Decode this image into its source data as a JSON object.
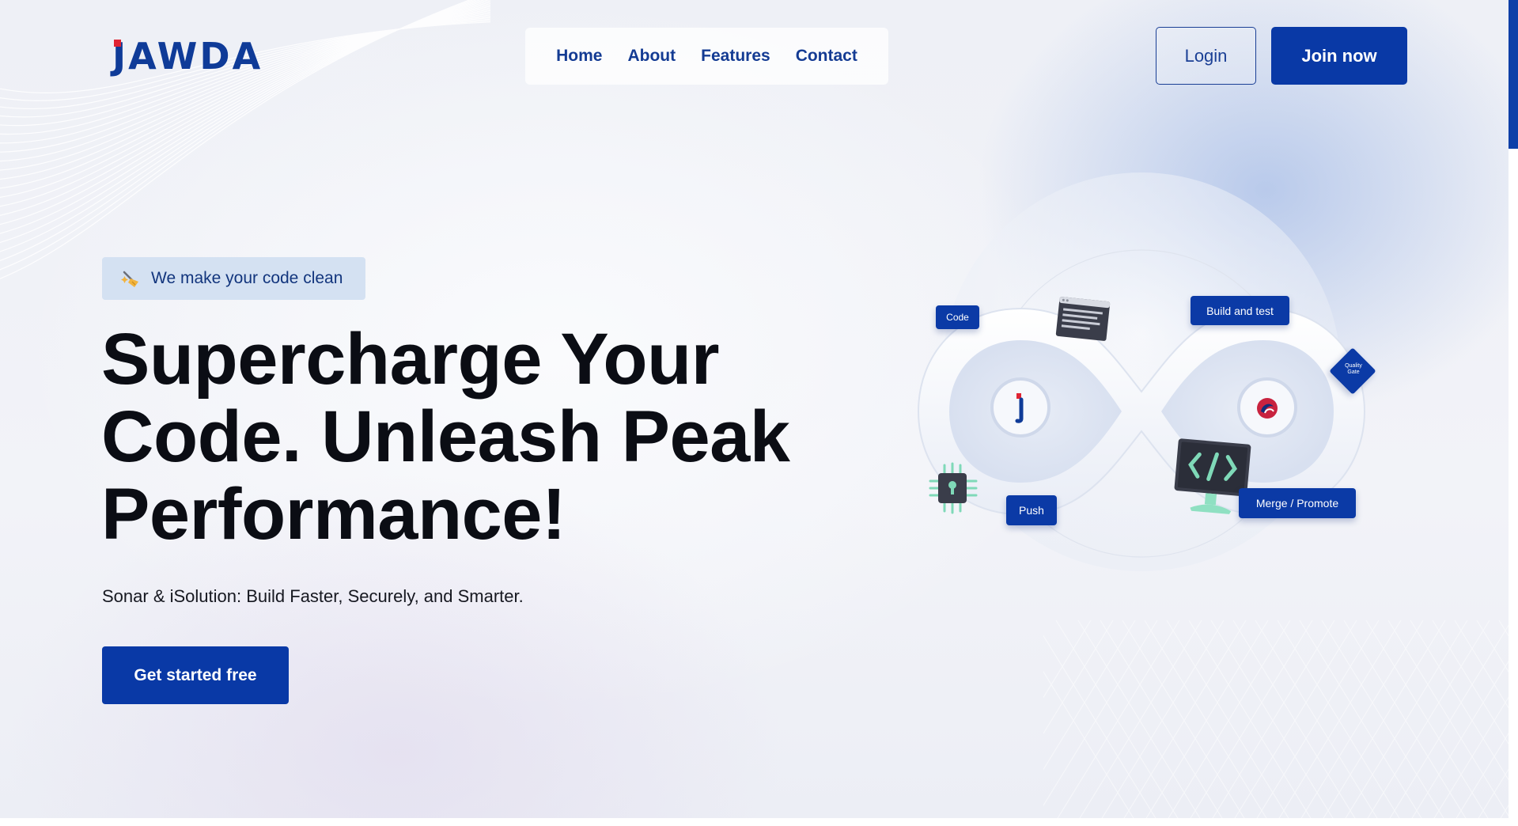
{
  "header": {
    "logo_text": "JAWDA",
    "nav": [
      {
        "label": "Home"
      },
      {
        "label": "About"
      },
      {
        "label": "Features"
      },
      {
        "label": "Contact"
      }
    ],
    "login_label": "Login",
    "join_label": "Join now"
  },
  "hero": {
    "badge_text": "We make your code clean",
    "title_lines": [
      "Supercharge Your",
      "Code. Unleash Peak",
      "Performance!"
    ],
    "subtitle": "Sonar & iSolution: Build Faster, Securely, and Smarter.",
    "cta_label": "Get started free"
  },
  "illustration": {
    "tags": {
      "code": "Code",
      "build": "Build and test",
      "quality_line1": "Quality",
      "quality_line2": "Gate",
      "push": "Push",
      "merge": "Merge / Promote"
    },
    "icons": [
      "terminal-window-icon",
      "chip-lock-icon",
      "monitor-code-icon",
      "isolution-logo-icon",
      "sonar-logo-icon"
    ]
  },
  "colors": {
    "primary": "#0939a6",
    "nav_text": "#143b93",
    "logo_accent": "#e02433",
    "badge_bg": "#d4e1f2",
    "heading": "#0b0d14"
  }
}
